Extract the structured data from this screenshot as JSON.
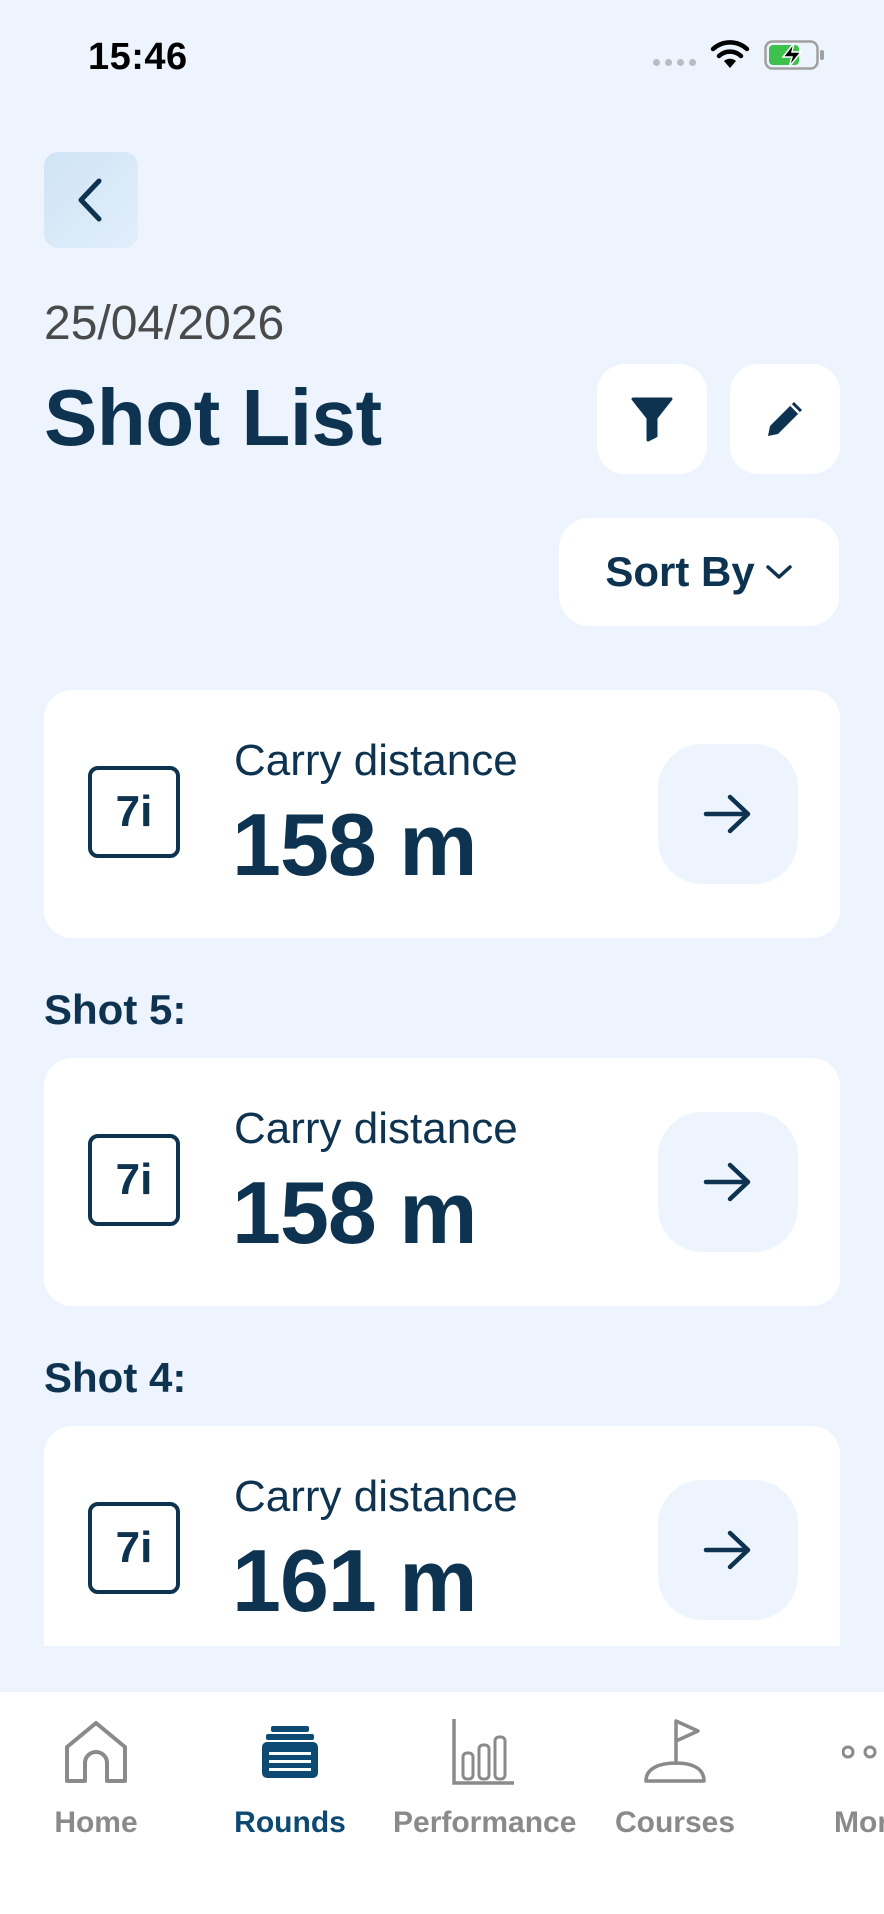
{
  "status_bar": {
    "time": "15:46"
  },
  "header": {
    "date": "25/04/2026",
    "title": "Shot List",
    "sort_label": "Sort By"
  },
  "shots": [
    {
      "label": "",
      "club": "7i",
      "carry_label": "Carry distance",
      "carry_value": "158 m"
    },
    {
      "label": "Shot 5:",
      "club": "7i",
      "carry_label": "Carry distance",
      "carry_value": "158 m"
    },
    {
      "label": "Shot 4:",
      "club": "7i",
      "carry_label": "Carry distance",
      "carry_value": "161 m"
    }
  ],
  "tabs": [
    {
      "label": "Home",
      "icon": "home-icon",
      "active": false
    },
    {
      "label": "Rounds",
      "icon": "rounds-icon",
      "active": true
    },
    {
      "label": "Performance",
      "icon": "bar-chart-icon",
      "active": false
    },
    {
      "label": "Courses",
      "icon": "flag-icon",
      "active": false
    },
    {
      "label": "Mor",
      "icon": "more-icon",
      "active": false
    }
  ],
  "colors": {
    "accent": "#0d3350",
    "background": "#eef4fd",
    "active_tab": "#0d4a73",
    "inactive_tab": "#8a8a8a"
  }
}
